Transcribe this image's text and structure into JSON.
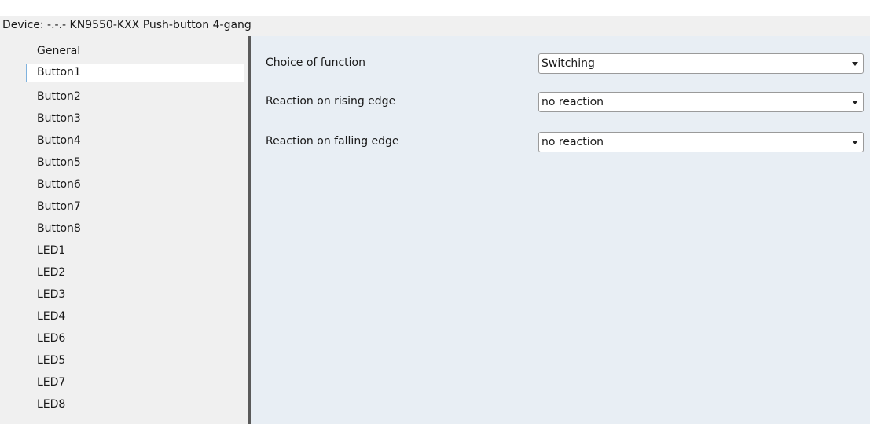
{
  "header": {
    "title": "Device: -.-.-  KN9550-KXX Push-button 4-gang"
  },
  "sidebar": {
    "items": [
      {
        "label": "General"
      },
      {
        "label": "Button1",
        "selected": true
      },
      {
        "label": "Button2"
      },
      {
        "label": "Button3"
      },
      {
        "label": "Button4"
      },
      {
        "label": "Button5"
      },
      {
        "label": "Button6"
      },
      {
        "label": "Button7"
      },
      {
        "label": "Button8"
      },
      {
        "label": "LED1"
      },
      {
        "label": "LED2"
      },
      {
        "label": "LED3"
      },
      {
        "label": "LED4"
      },
      {
        "label": "LED6"
      },
      {
        "label": "LED5"
      },
      {
        "label": "LED7"
      },
      {
        "label": "LED8"
      }
    ]
  },
  "params": [
    {
      "label": "Choice of function",
      "value": "Switching"
    },
    {
      "label": "Reaction on rising edge",
      "value": "no reaction"
    },
    {
      "label": "Reaction on falling edge",
      "value": "no reaction"
    }
  ]
}
